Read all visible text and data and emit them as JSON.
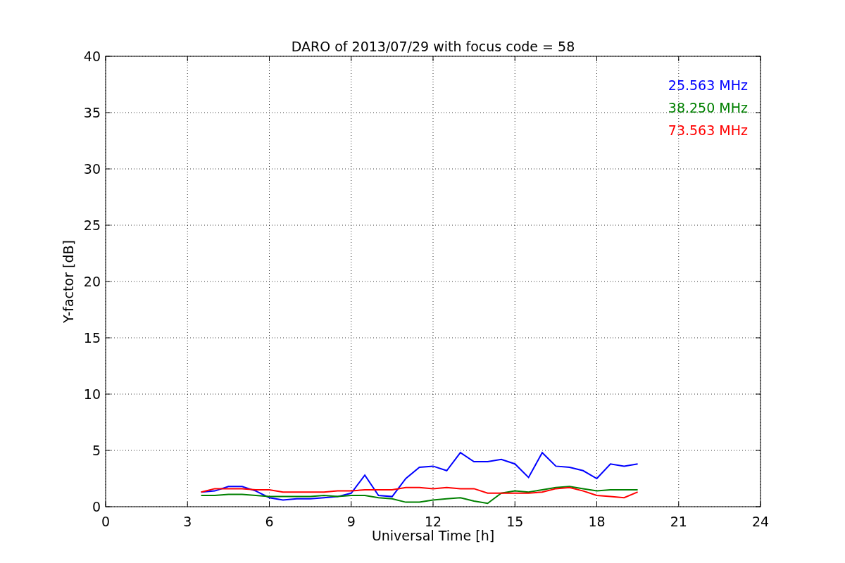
{
  "chart_data": {
    "type": "line",
    "title": "DARO of 2013/07/29 with focus code = 58",
    "xlabel": "Universal Time [h]",
    "ylabel": "Y-factor [dB]",
    "x": [
      3.5,
      4,
      4.5,
      5,
      5.5,
      6,
      6.5,
      7,
      7.5,
      8,
      8.5,
      9,
      9.5,
      10,
      10.5,
      11,
      11.5,
      12,
      12.5,
      13,
      13.5,
      14,
      14.5,
      15,
      15.5,
      16,
      16.5,
      17,
      17.5,
      18,
      18.5,
      19,
      19.5
    ],
    "series": [
      {
        "name": "25.563 MHz",
        "color": "#0000ff",
        "values": [
          1.3,
          1.4,
          1.8,
          1.8,
          1.4,
          0.8,
          0.6,
          0.7,
          0.7,
          0.8,
          0.9,
          1.2,
          2.8,
          1.0,
          0.9,
          2.5,
          3.5,
          3.6,
          3.2,
          4.8,
          4.0,
          4.0,
          4.2,
          3.8,
          2.6,
          4.8,
          3.6,
          3.5,
          3.2,
          2.5,
          3.8,
          3.6,
          3.8
        ]
      },
      {
        "name": "38.250 MHz",
        "color": "#008000",
        "values": [
          1.0,
          1.0,
          1.1,
          1.1,
          1.0,
          0.9,
          0.9,
          0.9,
          0.9,
          1.0,
          0.9,
          1.0,
          1.0,
          0.8,
          0.7,
          0.4,
          0.4,
          0.6,
          0.7,
          0.8,
          0.5,
          0.3,
          1.2,
          1.4,
          1.3,
          1.5,
          1.7,
          1.8,
          1.6,
          1.4,
          1.5,
          1.5,
          1.5
        ]
      },
      {
        "name": "73.563 MHz",
        "color": "#ff0000",
        "values": [
          1.3,
          1.6,
          1.6,
          1.6,
          1.5,
          1.5,
          1.3,
          1.3,
          1.3,
          1.3,
          1.4,
          1.4,
          1.5,
          1.5,
          1.5,
          1.7,
          1.7,
          1.6,
          1.7,
          1.6,
          1.6,
          1.2,
          1.2,
          1.2,
          1.2,
          1.3,
          1.6,
          1.7,
          1.4,
          1.0,
          0.9,
          0.8,
          1.3
        ]
      }
    ],
    "xlim": [
      0,
      24
    ],
    "ylim": [
      0,
      40
    ],
    "xticks": [
      0,
      3,
      6,
      9,
      12,
      15,
      18,
      21,
      24
    ],
    "yticks": [
      0,
      5,
      10,
      15,
      20,
      25,
      30,
      35,
      40
    ],
    "grid": true
  }
}
